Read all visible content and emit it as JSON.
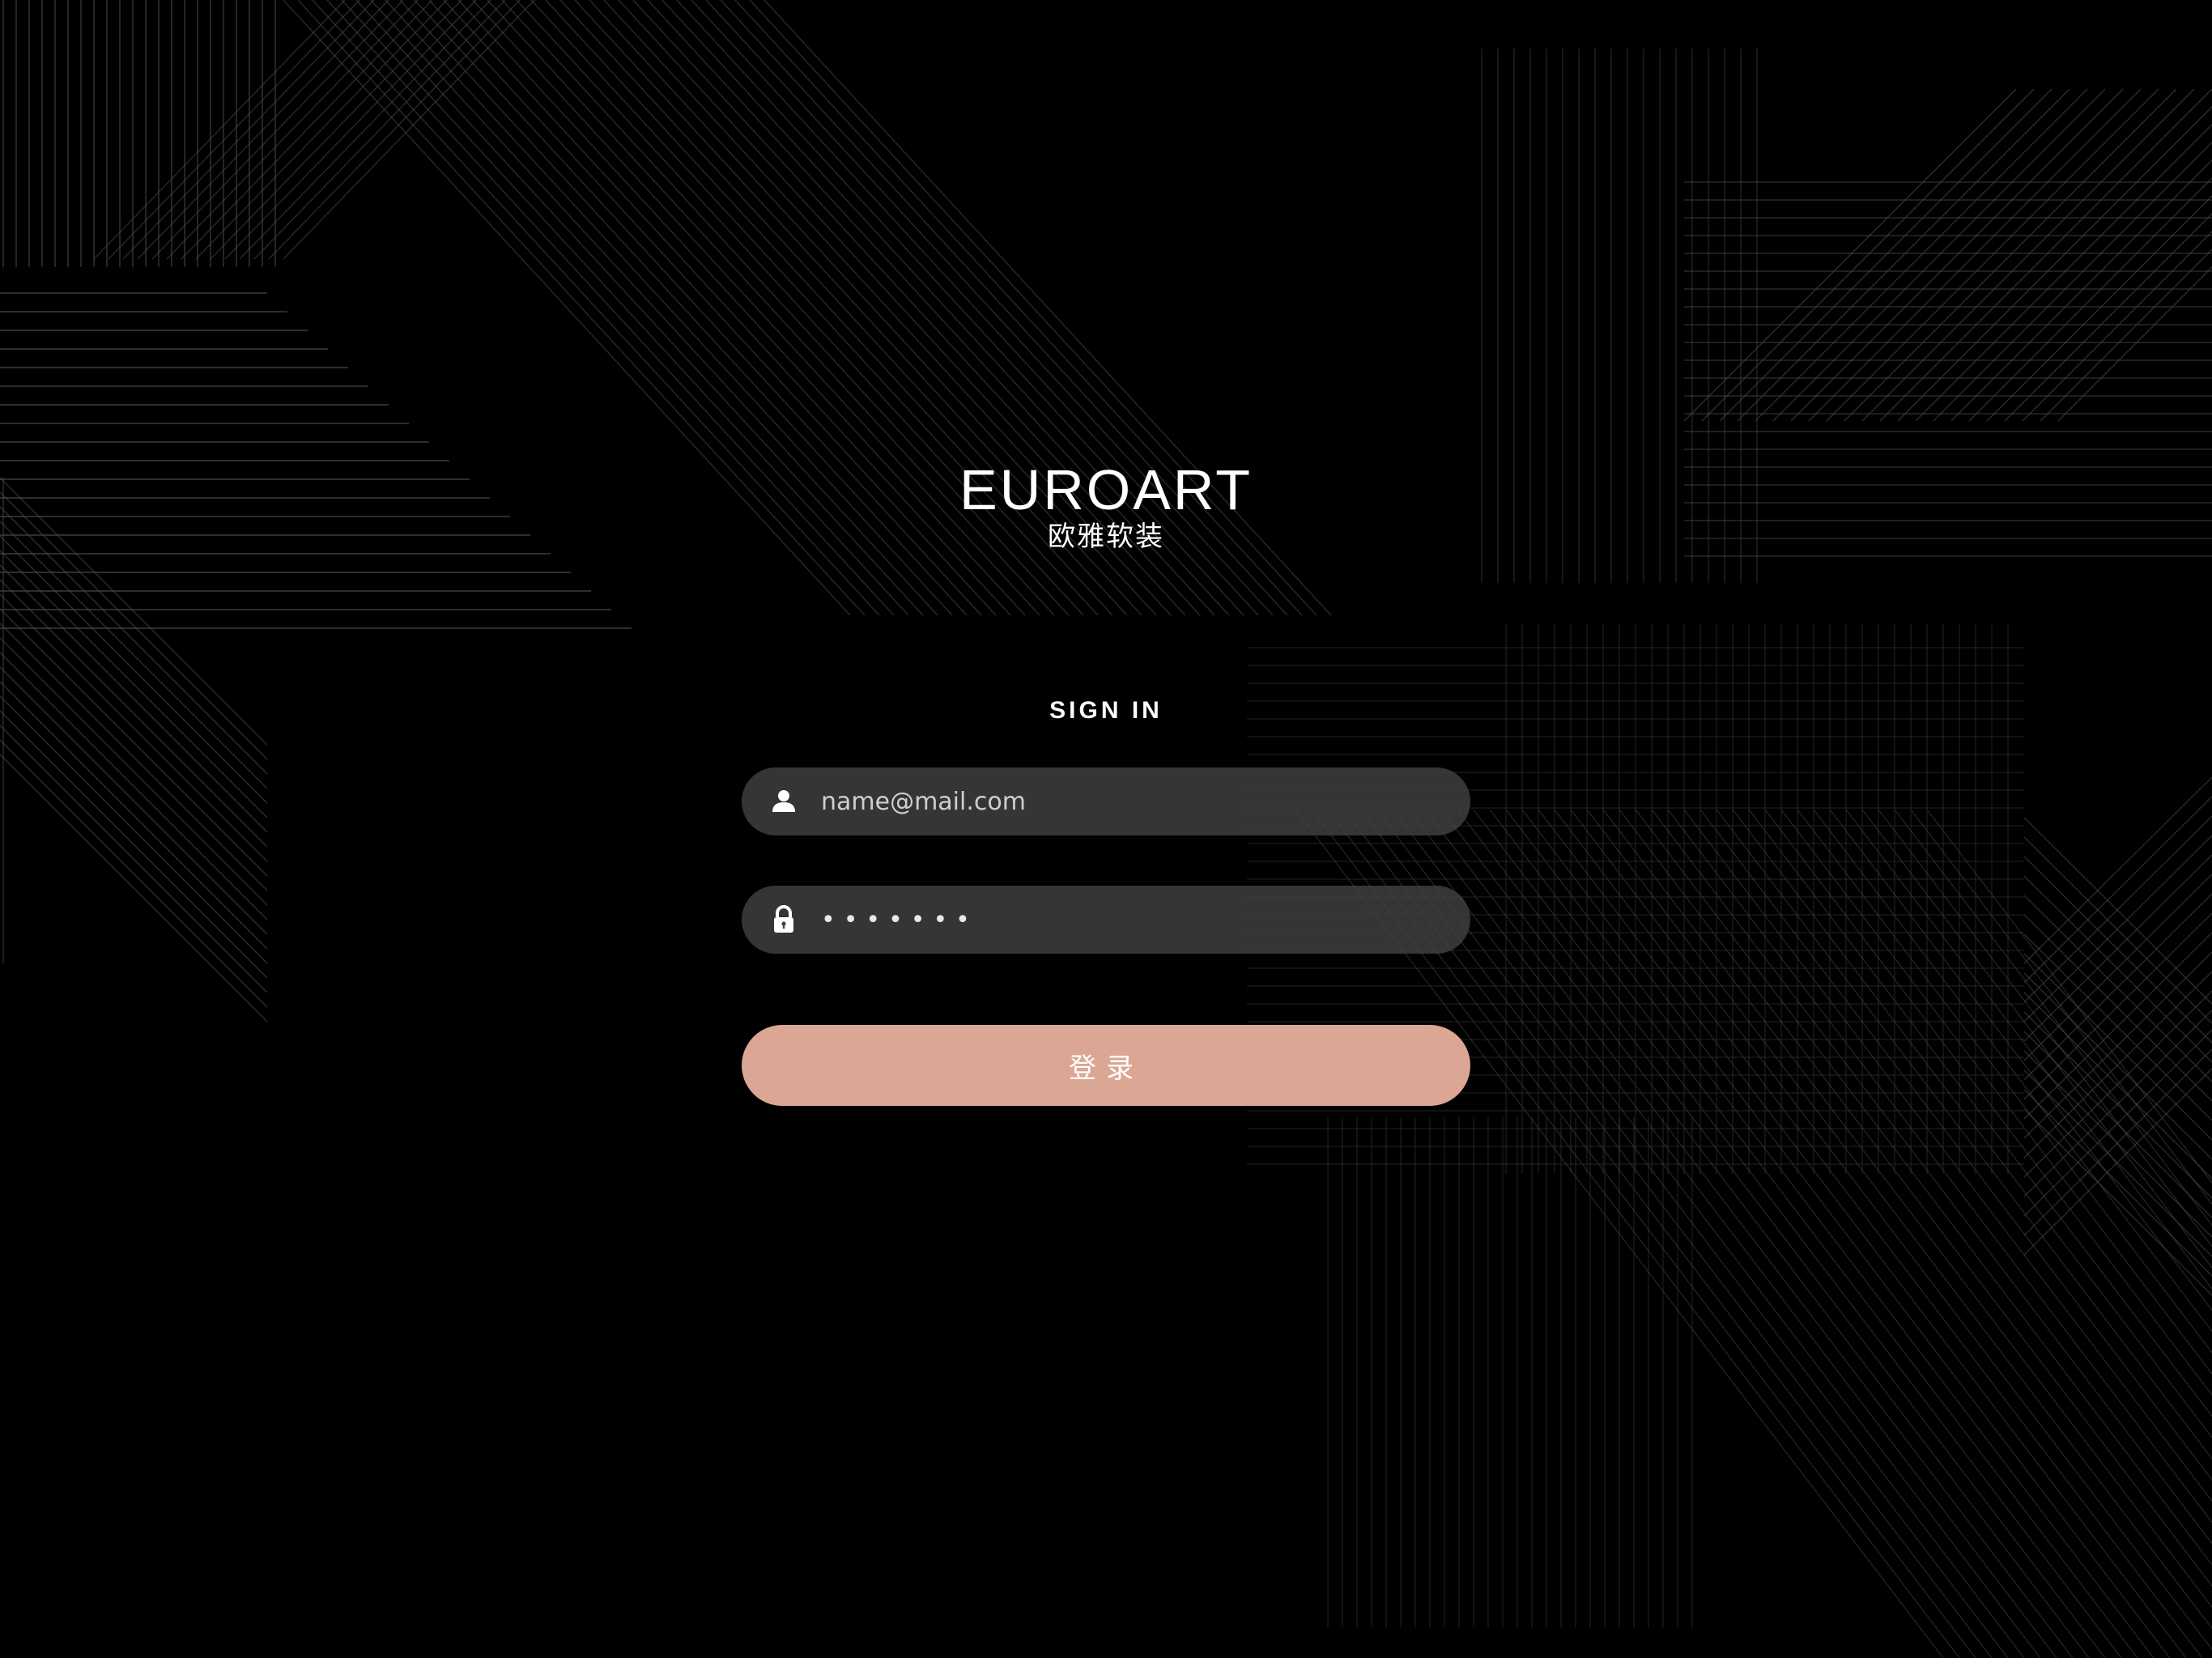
{
  "brand": {
    "title": "EUROART",
    "subtitle": "欧雅软装"
  },
  "form": {
    "heading": "SIGN IN",
    "email": {
      "icon": "user-icon",
      "placeholder": "name@mail.com",
      "value": ""
    },
    "password": {
      "icon": "lock-icon",
      "value": "1234567"
    },
    "submit_label": "登录"
  },
  "colors": {
    "background": "#000000",
    "input_background": "#444444",
    "button": "#dba694",
    "text": "#ffffff"
  }
}
